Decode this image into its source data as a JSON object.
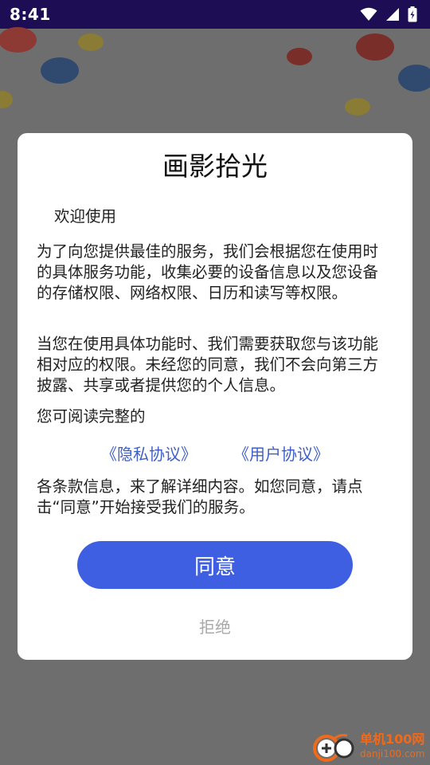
{
  "status_bar": {
    "time": "8:41"
  },
  "dialog": {
    "title": "画影拾光",
    "welcome": "欢迎使用",
    "paragraph_1": "为了向您提供最佳的服务，我们会根据您在使用时的具体服务功能，收集必要的设备信息以及您设备的存储权限、网络权限、日历和读写等权限。",
    "paragraph_2": "当您在使用具体功能时、我们需要获取您与该功能相对应的权限。未经您的同意，我们不会向第三方披露、共享或者提供您的个人信息。",
    "paragraph_3": "您可阅读完整的",
    "privacy_link": "《隐私协议》",
    "user_link": "《用户协议》",
    "paragraph_4": "各条款信息，来了解详细内容。如您同意，请点击“同意”开始接受我们的服务。",
    "agree_label": "同意",
    "reject_label": "拒绝"
  },
  "watermark": {
    "main": "单机100网",
    "sub": "danji100.com"
  },
  "colors": {
    "accent": "#3f5fe3",
    "link": "#3f5fc8",
    "status_bar": "#1d0d54"
  }
}
